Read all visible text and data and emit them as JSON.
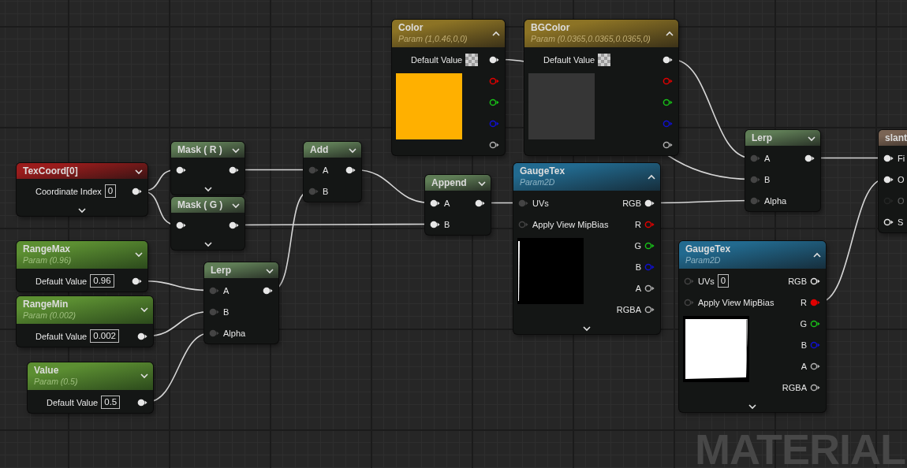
{
  "nodes": [
    {
      "title": "Color",
      "subtitle": "Param (1,0.46,0,0)",
      "kind": "vector",
      "expanded": true,
      "advanced_pins": false,
      "inputs": [
        {
          "kind": "property",
          "label": "Default Value",
          "swatch_icon": true
        }
      ],
      "outputs": [
        {
          "kind": "vector",
          "connected": true
        },
        {
          "kind": "red",
          "connected": false
        },
        {
          "kind": "green",
          "connected": false
        },
        {
          "kind": "blue",
          "connected": false
        },
        {
          "kind": "alpha",
          "connected": false
        }
      ],
      "preview": {
        "kind": "swatch",
        "color": "#ffb000"
      }
    },
    {
      "title": "BGColor",
      "subtitle": "Param (0.0365,0.0365,0.0365,0)",
      "kind": "vector",
      "expanded": true,
      "advanced_pins": false,
      "inputs": [
        {
          "kind": "property",
          "label": "Default Value",
          "swatch_icon": true
        }
      ],
      "outputs": [
        {
          "kind": "vector",
          "connected": true
        },
        {
          "kind": "red",
          "connected": false
        },
        {
          "kind": "green",
          "connected": false
        },
        {
          "kind": "blue",
          "connected": false
        },
        {
          "kind": "alpha",
          "connected": false
        }
      ],
      "preview": {
        "kind": "swatch",
        "color": "#363636"
      }
    },
    {
      "title": "TexCoord[0]",
      "kind": "coordinate",
      "expanded": false,
      "advanced_pins": true,
      "inputs": [
        {
          "kind": "property",
          "label": "Coordinate Index",
          "value": "0"
        }
      ],
      "outputs": [
        {
          "kind": "vector",
          "connected": true
        }
      ]
    },
    {
      "title": "Mask ( R )",
      "kind": "math",
      "expanded": false,
      "advanced_pins": true,
      "inputs": [
        {
          "kind": "vector",
          "connected": true
        }
      ],
      "outputs": [
        {
          "kind": "vector",
          "connected": true
        }
      ]
    },
    {
      "title": "Mask ( G )",
      "kind": "math",
      "expanded": false,
      "advanced_pins": true,
      "inputs": [
        {
          "kind": "vector",
          "connected": true
        }
      ],
      "outputs": [
        {
          "kind": "vector",
          "connected": true
        }
      ]
    },
    {
      "title": "Add",
      "kind": "math",
      "expanded": false,
      "advanced_pins": false,
      "inputs": [
        {
          "label": "A",
          "kind": "float",
          "connected": true
        },
        {
          "label": "B",
          "kind": "float",
          "connected": true
        }
      ],
      "outputs": [
        {
          "kind": "vector",
          "connected": true
        }
      ]
    },
    {
      "title": "Append",
      "kind": "math",
      "expanded": false,
      "advanced_pins": false,
      "inputs": [
        {
          "label": "A",
          "kind": "vector",
          "connected": true
        },
        {
          "label": "B",
          "kind": "vector",
          "connected": true
        }
      ],
      "outputs": [
        {
          "kind": "vector",
          "connected": true
        }
      ]
    },
    {
      "title": "GaugeTex",
      "subtitle": "Param2D",
      "kind": "texture",
      "expanded": true,
      "advanced_pins": true,
      "inputs": [
        {
          "label": "UVs",
          "kind": "float",
          "connected": true
        },
        {
          "label": "Apply View MipBias",
          "kind": "float",
          "connected": false
        }
      ],
      "outputs": [
        {
          "label": "RGB",
          "kind": "vector",
          "connected": true
        },
        {
          "label": "R",
          "kind": "red",
          "connected": false
        },
        {
          "label": "G",
          "kind": "green",
          "connected": false
        },
        {
          "label": "B",
          "kind": "blue",
          "connected": false
        },
        {
          "label": "A",
          "kind": "alpha",
          "connected": false
        },
        {
          "label": "RGBA",
          "kind": "alpha",
          "connected": false
        }
      ],
      "preview": {
        "kind": "dark"
      }
    },
    {
      "title": "Lerp",
      "kind": "math",
      "expanded": false,
      "advanced_pins": false,
      "inputs": [
        {
          "label": "A",
          "kind": "float",
          "connected": true
        },
        {
          "label": "B",
          "kind": "float",
          "connected": true
        },
        {
          "label": "Alpha",
          "kind": "float",
          "connected": true
        }
      ],
      "outputs": [
        {
          "kind": "vector",
          "connected": true
        }
      ]
    },
    {
      "title": "slant",
      "kind": "function",
      "advanced_pins": false,
      "inputs": [
        {
          "label": "Fi",
          "kind": "vector",
          "connected": true,
          "disabled": false
        },
        {
          "label": "O",
          "kind": "vector",
          "connected": true,
          "disabled": false
        },
        {
          "label": "O",
          "kind": "float",
          "connected": false,
          "disabled": true
        },
        {
          "label": "S",
          "kind": "vector",
          "connected": false,
          "disabled": false
        }
      ]
    },
    {
      "title": "RangeMax",
      "subtitle": "Param (0.96)",
      "kind": "scalar",
      "expanded": false,
      "advanced_pins": false,
      "inputs": [
        {
          "kind": "property",
          "label": "Default Value",
          "value": "0.96"
        }
      ],
      "outputs": [
        {
          "kind": "vector",
          "connected": true
        }
      ]
    },
    {
      "title": "RangeMin",
      "subtitle": "Param (0.002)",
      "kind": "scalar",
      "expanded": false,
      "advanced_pins": false,
      "inputs": [
        {
          "kind": "property",
          "label": "Default Value",
          "value": "0.002"
        }
      ],
      "outputs": [
        {
          "kind": "vector",
          "connected": true
        }
      ]
    },
    {
      "title": "Value",
      "subtitle": "Param (0.5)",
      "kind": "scalar",
      "expanded": false,
      "advanced_pins": false,
      "inputs": [
        {
          "kind": "property",
          "label": "Default Value",
          "value": "0.5"
        }
      ],
      "outputs": [
        {
          "kind": "vector",
          "connected": true
        }
      ]
    },
    {
      "title": "Lerp",
      "kind": "math",
      "expanded": false,
      "advanced_pins": false,
      "inputs": [
        {
          "label": "A",
          "kind": "float",
          "connected": true
        },
        {
          "label": "B",
          "kind": "float",
          "connected": true
        },
        {
          "label": "Alpha",
          "kind": "float",
          "connected": true
        }
      ],
      "outputs": [
        {
          "kind": "vector",
          "connected": true
        }
      ]
    },
    {
      "title": "GaugeTex",
      "subtitle": "Param2D",
      "kind": "texture",
      "expanded": true,
      "advanced_pins": true,
      "inputs": [
        {
          "label": "UVs",
          "kind": "float",
          "connected": false,
          "value": "0"
        },
        {
          "label": "Apply View MipBias",
          "kind": "float",
          "connected": false
        }
      ],
      "outputs": [
        {
          "label": "RGB",
          "kind": "vector",
          "connected": false
        },
        {
          "label": "R",
          "kind": "red",
          "connected": true
        },
        {
          "label": "G",
          "kind": "green",
          "connected": false
        },
        {
          "label": "B",
          "kind": "blue",
          "connected": false
        },
        {
          "label": "A",
          "kind": "alpha",
          "connected": false
        },
        {
          "label": "RGBA",
          "kind": "alpha",
          "connected": false
        }
      ],
      "preview": {
        "kind": "light"
      }
    }
  ],
  "graph_label": "MATERIAL"
}
